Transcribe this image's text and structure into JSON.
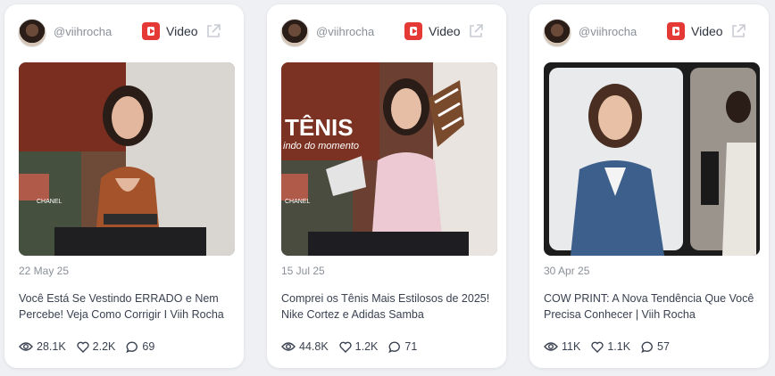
{
  "cards": [
    {
      "handle": "@viihrocha",
      "type_label": "Video",
      "date": "22 May 25",
      "title": "Você Está Se Vestindo ERRADO e Nem Percebe! Veja Como Corrigir I Viih Rocha",
      "views": "28.1K",
      "likes": "2.2K",
      "comments": "69",
      "thumb_text": "CHANEL"
    },
    {
      "handle": "@viihrocha",
      "type_label": "Video",
      "date": "15 Jul 25",
      "title": "Comprei os Tênis Mais Estilosos de 2025! Nike Cortez e Adidas Samba",
      "views": "44.8K",
      "likes": "1.2K",
      "comments": "71",
      "thumb_title": "TÊNIS",
      "thumb_sub": "indo do momento",
      "thumb_text": "CHANEL"
    },
    {
      "handle": "@viihrocha",
      "type_label": "Video",
      "date": "30 Apr 25",
      "title": "COW PRINT: A Nova Tendência Que Você Precisa Conhecer | Viih Rocha",
      "views": "11K",
      "likes": "1.1K",
      "comments": "57"
    }
  ],
  "icons": {
    "platform": "youtube-icon",
    "external": "external-link-icon",
    "views": "eye-icon",
    "likes": "heart-icon",
    "comments": "comment-icon"
  },
  "colors": {
    "youtube_red": "#e53935",
    "text": "#3a4150",
    "muted": "#8a8f98"
  }
}
